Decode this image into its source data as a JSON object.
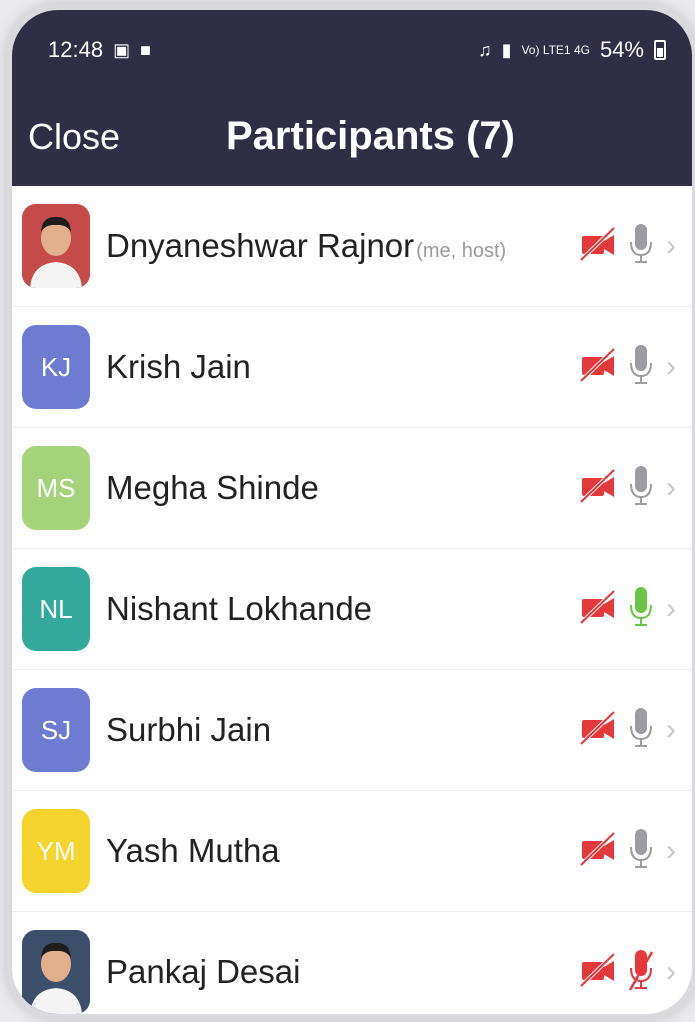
{
  "status_bar": {
    "time": "12:48",
    "signal_text": "Vo) LTE1 4G",
    "battery": "54%"
  },
  "header": {
    "close_label": "Close",
    "title": "Participants (7)"
  },
  "colors": {
    "header_bg": "#2f2e45",
    "video_off": "#e5383b",
    "mic_muted_gray": "#9c9ca3",
    "mic_active": "#6cc447",
    "mic_off_red": "#e5383b"
  },
  "participants": [
    {
      "name": "Dnyaneshwar Rajnor",
      "tag": "(me, host)",
      "initials": "",
      "avatar_color": "#c54a4a",
      "photo": true,
      "mic": "muted"
    },
    {
      "name": "Krish Jain",
      "tag": "",
      "initials": "KJ",
      "avatar_color": "#6d7bd0",
      "photo": false,
      "mic": "muted"
    },
    {
      "name": "Megha Shinde",
      "tag": "",
      "initials": "MS",
      "avatar_color": "#a4d37c",
      "photo": false,
      "mic": "muted"
    },
    {
      "name": "Nishant Lokhande",
      "tag": "",
      "initials": "NL",
      "avatar_color": "#34a89c",
      "photo": false,
      "mic": "active"
    },
    {
      "name": "Surbhi Jain",
      "tag": "",
      "initials": "SJ",
      "avatar_color": "#6d7bd0",
      "photo": false,
      "mic": "muted"
    },
    {
      "name": "Yash Mutha",
      "tag": "",
      "initials": "YM",
      "avatar_color": "#f5d42e",
      "photo": false,
      "mic": "muted"
    },
    {
      "name": "Pankaj Desai",
      "tag": "",
      "initials": "",
      "avatar_color": "#3c4f6b",
      "photo": true,
      "mic": "off"
    }
  ]
}
